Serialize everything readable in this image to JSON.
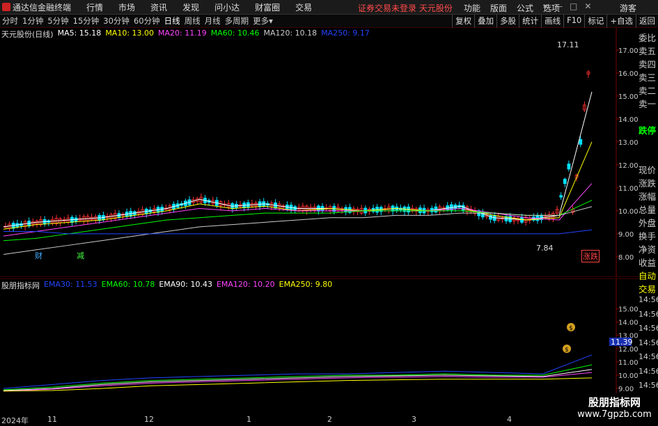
{
  "app": {
    "title": "通达信金融终端",
    "menu": [
      "行情",
      "市场",
      "资讯",
      "发现",
      "问小达",
      "财富圈",
      "交易"
    ],
    "warning": "证券交易未登录  天元股份",
    "right_menu": [
      "功能",
      "版面",
      "公式",
      "选项"
    ],
    "guest": "游客"
  },
  "periods": [
    "分时",
    "1分钟",
    "5分钟",
    "15分钟",
    "30分钟",
    "60分钟",
    "日线",
    "周线",
    "月线",
    "多周期",
    "更多"
  ],
  "active_period": "日线",
  "tools": [
    "复权",
    "叠加",
    "多股",
    "统计",
    "画线",
    "F10",
    "标记",
    "+自选",
    "返回"
  ],
  "main": {
    "stock": "天元股份(日线)",
    "ma": [
      {
        "label": "MA5: 15.18",
        "color": "#ffffff"
      },
      {
        "label": "MA10: 13.00",
        "color": "#ffff00"
      },
      {
        "label": "MA20: 11.19",
        "color": "#ff44ff"
      },
      {
        "label": "MA60: 10.46",
        "color": "#00ff00"
      },
      {
        "label": "MA120: 10.18",
        "color": "#cccccc"
      },
      {
        "label": "MA250: 9.17",
        "color": "#2244ff"
      }
    ],
    "yticks": [
      "17.00",
      "16.00",
      "15.00",
      "14.00",
      "13.00",
      "12.00",
      "11.00",
      "10.00",
      "9.00",
      "8.00"
    ],
    "high_label": "17.11",
    "low_label": "7.84",
    "markers": [
      "财",
      "减",
      "涨跌"
    ]
  },
  "sub": {
    "name": "股朋指标网",
    "ema": [
      {
        "label": "EMA30: 11.53",
        "color": "#2244ff"
      },
      {
        "label": "EMA60: 10.78",
        "color": "#00ff00"
      },
      {
        "label": "EMA90: 10.43",
        "color": "#ffffff"
      },
      {
        "label": "EMA120: 10.20",
        "color": "#ff44ff"
      },
      {
        "label": "EMA250: 9.80",
        "color": "#ffff00"
      }
    ],
    "yticks": [
      "15.00",
      "14.00",
      "13.00",
      "12.00",
      "11.00",
      "10.00",
      "9.00"
    ],
    "current": "11.39"
  },
  "right_panel": [
    "委比",
    "卖五",
    "卖四",
    "卖三",
    "卖二",
    "卖一",
    "",
    "跌停",
    "",
    "",
    "现价",
    "涨跌",
    "涨幅",
    "总量",
    "外盘",
    "换手",
    "净资",
    "收益",
    "自动",
    "交易",
    "14:56",
    "14:56",
    "14:56",
    "14:56",
    "14:56",
    "14:56",
    "14:56",
    "14:56"
  ],
  "xaxis": [
    "2024年",
    "11",
    "12",
    "1",
    "2",
    "3",
    "4"
  ],
  "watermark": {
    "line1": "股朋指标网",
    "line2": "www.7gpzb.com"
  },
  "chart_data": {
    "type": "line",
    "title": "天元股份(日线)",
    "series": [
      {
        "name": "MA5",
        "values": [
          9.3,
          9.5,
          9.6,
          9.7,
          9.9,
          10.1,
          10.5,
          10.2,
          10.3,
          10.1,
          10.1,
          10.0,
          10.1,
          10.0,
          10.2,
          9.7,
          9.6,
          9.8,
          15.18
        ]
      },
      {
        "name": "MA10",
        "values": [
          9.2,
          9.4,
          9.5,
          9.6,
          9.8,
          10.0,
          10.3,
          10.1,
          10.2,
          10.0,
          10.1,
          10.0,
          10.1,
          10.0,
          10.1,
          9.8,
          9.6,
          9.7,
          13.0
        ]
      },
      {
        "name": "MA20",
        "values": [
          8.9,
          9.1,
          9.3,
          9.5,
          9.7,
          9.9,
          10.1,
          10.0,
          10.1,
          10.0,
          10.0,
          10.0,
          10.0,
          10.0,
          10.1,
          9.9,
          9.7,
          9.6,
          11.19
        ]
      },
      {
        "name": "MA60",
        "values": [
          8.7,
          8.8,
          9.0,
          9.2,
          9.4,
          9.6,
          9.7,
          9.8,
          9.9,
          9.9,
          9.9,
          10.0,
          10.0,
          10.0,
          10.0,
          9.9,
          9.8,
          9.8,
          10.46
        ]
      },
      {
        "name": "MA120",
        "values": [
          8.1,
          8.3,
          8.5,
          8.7,
          8.9,
          9.1,
          9.3,
          9.4,
          9.5,
          9.6,
          9.7,
          9.7,
          9.8,
          9.8,
          9.9,
          9.9,
          9.8,
          9.8,
          10.18
        ]
      },
      {
        "name": "MA250",
        "values": [
          9.1,
          9.1,
          9.0,
          9.0,
          9.0,
          9.0,
          9.0,
          9.0,
          9.0,
          9.0,
          9.0,
          9.0,
          9.0,
          9.0,
          9.0,
          9.0,
          9.0,
          9.0,
          9.17
        ]
      }
    ],
    "ylim": [
      7.6,
      17.3
    ]
  }
}
